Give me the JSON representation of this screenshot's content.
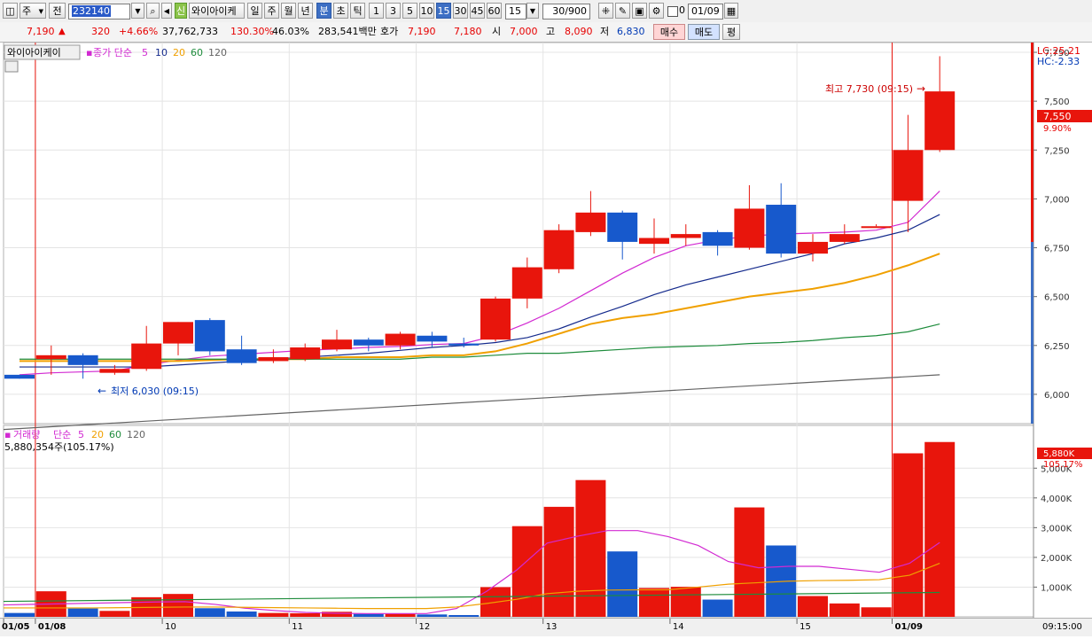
{
  "toolbar": {
    "type_label": "주",
    "market_label": "전",
    "code": "232140",
    "badge_new": "신",
    "name_short": "와이아이케",
    "period_buttons": [
      "일",
      "주",
      "월",
      "년",
      "분",
      "초",
      "틱"
    ],
    "period_selected": "분",
    "interval_buttons": [
      "1",
      "3",
      "5",
      "10",
      "15",
      "30",
      "45",
      "60"
    ],
    "interval_selected": "15",
    "interval_select_value": "15",
    "count_value": "30/900",
    "date_value": "01/09",
    "zero_label": "0"
  },
  "quote": {
    "price": "7,190",
    "change_arrow": "▲",
    "change": "320",
    "change_pct": "+4.66%",
    "volume": "37,762,733",
    "vol_ratio": "130.30%",
    "turnover": "46.03%",
    "amount": "283,541백만",
    "hoga_label": "호가",
    "hoga_sell": "7,190",
    "hoga_buy": "7,180",
    "open_label": "시",
    "open": "7,000",
    "high_label": "고",
    "high": "8,090",
    "low_label": "저",
    "low": "6,830",
    "buy_button": "매수",
    "sell_button": "매도",
    "avg_button": "평"
  },
  "price_panel": {
    "stock_name": "와이아이케이",
    "ma_label": "종가 단순",
    "ma_periods": [
      "5",
      "10",
      "20",
      "60",
      "120"
    ],
    "lc_label": "LC:25.21",
    "hc_label": "HC:-2.33",
    "high_annotation": "최고 7,730 (09:15)",
    "low_annotation": "최저 6,030 (09:15)",
    "current_price_tag": "7,550",
    "current_pct_tag": "9.90%"
  },
  "volume_panel": {
    "label": "거래량",
    "ma_label": "단순",
    "ma_periods": [
      "5",
      "20",
      "60",
      "120"
    ],
    "value_label": "5,880,354주(105.17%)",
    "current_tag": "5,880K",
    "current_pct_tag": "105.17%"
  },
  "bottom_axis": {
    "time_label": "09:15:00"
  },
  "colors": {
    "up": "#e8150c",
    "down": "#1759cc",
    "ma5": "#d22ad2",
    "ma10": "#142a8c",
    "ma20": "#f0a000",
    "ma60": "#1e8c3c",
    "ma120": "#646464"
  },
  "chart_data": [
    {
      "type": "candlestick",
      "title": "와이아이케이",
      "x": [
        "01/05",
        "01/08",
        "01/08",
        "01/08",
        "01/08",
        "01/10",
        "01/10",
        "01/10",
        "01/10",
        "01/11",
        "01/11",
        "01/11",
        "01/11",
        "01/12",
        "01/12",
        "01/12",
        "01/12",
        "01/13",
        "01/13",
        "01/13",
        "01/13",
        "01/14",
        "01/14",
        "01/14",
        "01/14",
        "01/15",
        "01/15",
        "01/15",
        "01/09",
        "01/09"
      ],
      "x_tick_labels": [
        "01/05",
        "01/08",
        "10",
        "11",
        "12",
        "13",
        "14",
        "15",
        "01/09"
      ],
      "ohlc": [
        [
          6100,
          6100,
          6080,
          6080
        ],
        [
          6180,
          6250,
          6100,
          6200
        ],
        [
          6200,
          6210,
          6080,
          6150
        ],
        [
          6110,
          6150,
          6100,
          6130
        ],
        [
          6130,
          6350,
          6120,
          6260
        ],
        [
          6260,
          6370,
          6200,
          6370
        ],
        [
          6380,
          6390,
          6200,
          6220
        ],
        [
          6230,
          6300,
          6150,
          6160
        ],
        [
          6170,
          6230,
          6160,
          6190
        ],
        [
          6180,
          6260,
          6170,
          6240
        ],
        [
          6230,
          6330,
          6220,
          6280
        ],
        [
          6280,
          6290,
          6220,
          6250
        ],
        [
          6250,
          6320,
          6230,
          6310
        ],
        [
          6300,
          6320,
          6240,
          6270
        ],
        [
          6260,
          6290,
          6240,
          6250
        ],
        [
          6280,
          6500,
          6270,
          6490
        ],
        [
          6490,
          6700,
          6440,
          6650
        ],
        [
          6640,
          6870,
          6620,
          6840
        ],
        [
          6830,
          7040,
          6810,
          6930
        ],
        [
          6930,
          6940,
          6690,
          6780
        ],
        [
          6770,
          6900,
          6720,
          6800
        ],
        [
          6800,
          6870,
          6760,
          6820
        ],
        [
          6830,
          6840,
          6710,
          6760
        ],
        [
          6750,
          7070,
          6740,
          6950
        ],
        [
          6970,
          7080,
          6700,
          6720
        ],
        [
          6720,
          6820,
          6680,
          6780
        ],
        [
          6780,
          6870,
          6770,
          6820
        ],
        [
          6860,
          6870,
          6860,
          6860
        ],
        [
          6990,
          7430,
          6830,
          7250
        ],
        [
          7250,
          7730,
          7240,
          7550
        ]
      ],
      "y_ticks": [
        6000,
        6250,
        6500,
        6750,
        7000,
        7250,
        7500,
        7750
      ],
      "ylim": [
        5850,
        7800
      ],
      "ma_series": [
        {
          "name": "5",
          "values": [
            6100,
            6110,
            6115,
            6120,
            6150,
            6175,
            6195,
            6205,
            6215,
            6225,
            6232,
            6240,
            6245,
            6255,
            6260,
            6300,
            6365,
            6440,
            6530,
            6620,
            6700,
            6760,
            6790,
            6810,
            6820,
            6825,
            6830,
            6840,
            6880,
            7040
          ]
        },
        {
          "name": "10",
          "values": [
            6140,
            6140,
            6140,
            6140,
            6140,
            6150,
            6160,
            6170,
            6180,
            6190,
            6200,
            6210,
            6225,
            6240,
            6250,
            6265,
            6290,
            6335,
            6395,
            6450,
            6510,
            6560,
            6600,
            6640,
            6680,
            6720,
            6770,
            6800,
            6840,
            6920
          ]
        },
        {
          "name": "20",
          "values": [
            6170,
            6170,
            6170,
            6170,
            6170,
            6170,
            6175,
            6180,
            6180,
            6180,
            6190,
            6190,
            6190,
            6200,
            6200,
            6220,
            6260,
            6310,
            6360,
            6390,
            6410,
            6440,
            6470,
            6500,
            6520,
            6540,
            6570,
            6610,
            6660,
            6720
          ]
        },
        {
          "name": "60",
          "values": [
            6180,
            6180,
            6180,
            6180,
            6180,
            6180,
            6180,
            6180,
            6180,
            6180,
            6180,
            6180,
            6180,
            6190,
            6190,
            6200,
            6210,
            6210,
            6220,
            6230,
            6240,
            6245,
            6250,
            6260,
            6265,
            6275,
            6290,
            6300,
            6320,
            6360
          ]
        }
      ]
    },
    {
      "type": "bar",
      "title": "거래량",
      "values": [
        130,
        860,
        280,
        200,
        660,
        770,
        290,
        180,
        130,
        120,
        170,
        100,
        100,
        80,
        60,
        1000,
        3050,
        3700,
        4600,
        2200,
        970,
        1010,
        580,
        3680,
        2400,
        700,
        450,
        320,
        5500,
        5880
      ],
      "unit": "K",
      "y_ticks": [
        1000,
        2000,
        3000,
        4000,
        5000
      ],
      "y_tick_labels": [
        "1,000K",
        "2,000K",
        "3,000K",
        "4,000K",
        "5,000K"
      ],
      "ylim": [
        0,
        6200
      ],
      "ma_series": [
        {
          "name": "5",
          "values": [
            400,
            420,
            440,
            460,
            480,
            500,
            510,
            420,
            290,
            210,
            150,
            120,
            110,
            110,
            110,
            280,
            860,
            1580,
            2480,
            2710,
            2900,
            2900,
            2700,
            2400,
            1860,
            1650,
            1700,
            1700,
            1600,
            1500,
            1800,
            2500
          ]
        },
        {
          "name": "20",
          "values": [
            300,
            300,
            300,
            300,
            310,
            320,
            330,
            330,
            320,
            310,
            300,
            290,
            280,
            280,
            280,
            330,
            450,
            590,
            780,
            860,
            900,
            910,
            910,
            1000,
            1100,
            1150,
            1200,
            1220,
            1230,
            1250,
            1400,
            1800
          ]
        }
      ]
    }
  ]
}
